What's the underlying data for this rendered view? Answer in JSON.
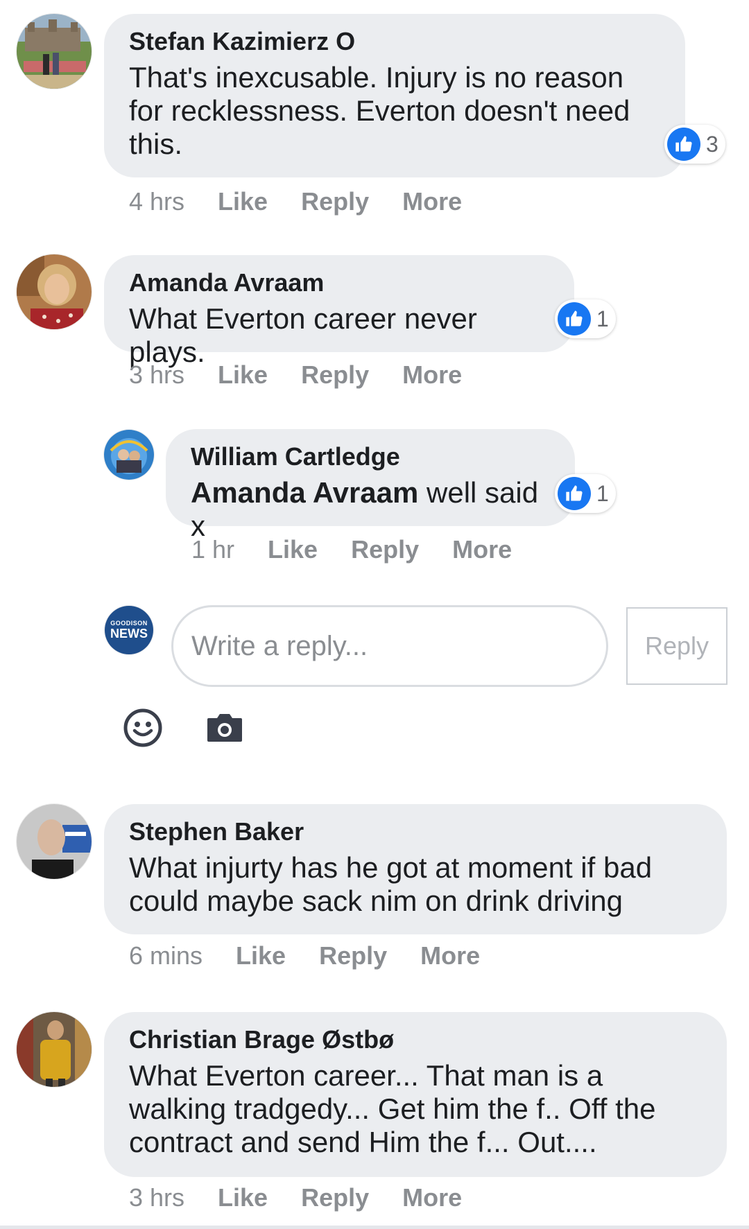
{
  "comments": [
    {
      "author": "Stefan Kazimierz O",
      "text": "That's inexcusable. Injury is no reason for recklessness. Everton doesn't need this.",
      "time": "4 hrs",
      "like": "Like",
      "reply": "Reply",
      "more": "More",
      "reactions": "3",
      "avatar_icon": "castle-photo-avatar"
    },
    {
      "author": "Amanda Avraam",
      "text": "What Everton career never plays.",
      "time": "3 hrs",
      "like": "Like",
      "reply": "Reply",
      "more": "More",
      "reactions": "1",
      "avatar_icon": "woman-photo-avatar",
      "replies": [
        {
          "author": "William Cartledge",
          "mention": "Amanda Avraam",
          "text": " well said x",
          "time": "1 hr",
          "like": "Like",
          "reply": "Reply",
          "more": "More",
          "reactions": "1",
          "avatar_icon": "family-photo-avatar"
        }
      ]
    },
    {
      "author": "Stephen Baker",
      "text": "What injurty has he got at moment if bad could maybe sack nim on drink driving",
      "time": "6 mins",
      "like": "Like",
      "reply": "Reply",
      "more": "More",
      "avatar_icon": "man-photo-avatar"
    },
    {
      "author": "Christian Brage Østbø",
      "text": "What Everton career... That man is a walking tradgedy... Get him the f.. Off the contract and send Him the f... Out....",
      "time": "3 hrs",
      "like": "Like",
      "reply": "Reply",
      "more": "More",
      "avatar_icon": "man-yellow-jacket-avatar"
    }
  ],
  "reply_box": {
    "avatar_line1": "GOODISON",
    "avatar_line2": "NEWS",
    "placeholder": "Write a reply...",
    "button": "Reply",
    "emoji_icon": "smiley-icon",
    "camera_icon": "camera-icon"
  },
  "colors": {
    "bubble": "#ebedf0",
    "like_blue": "#1877f2",
    "meta_gray": "#8a8d91",
    "goodison_blue": "#1f4e8c"
  }
}
